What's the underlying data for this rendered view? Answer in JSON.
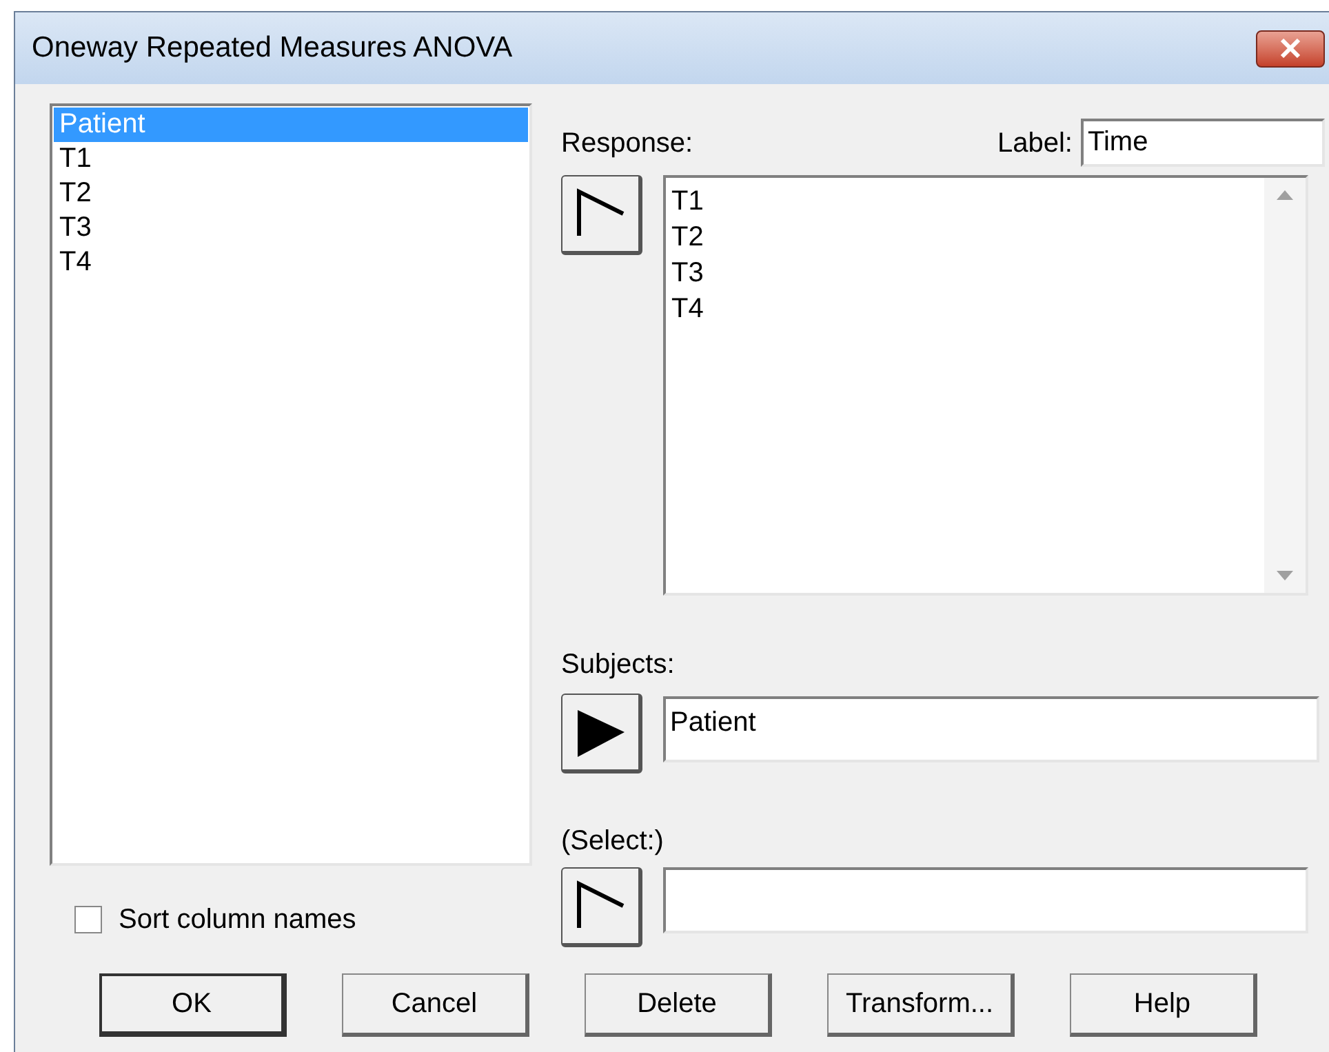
{
  "window": {
    "title": "Oneway Repeated Measures ANOVA"
  },
  "columns": [
    {
      "name": "Patient",
      "selected": true
    },
    {
      "name": "T1",
      "selected": false
    },
    {
      "name": "T2",
      "selected": false
    },
    {
      "name": "T3",
      "selected": false
    },
    {
      "name": "T4",
      "selected": false
    }
  ],
  "sort_column_names": {
    "label": "Sort column names",
    "checked": false
  },
  "response": {
    "label": "Response:",
    "arrow_active": false,
    "items": [
      "T1",
      "T2",
      "T3",
      "T4"
    ]
  },
  "label_field": {
    "label": "Label:",
    "value": "Time"
  },
  "subjects": {
    "label": "Subjects:",
    "arrow_active": true,
    "value": "Patient"
  },
  "select": {
    "label": "(Select:)",
    "arrow_active": false
  },
  "buttons": [
    {
      "label": "OK",
      "default": true
    },
    {
      "label": "Cancel",
      "default": false
    },
    {
      "label": "Delete",
      "default": false
    },
    {
      "label": "Transform...",
      "default": false
    },
    {
      "label": "Help",
      "default": false
    }
  ]
}
